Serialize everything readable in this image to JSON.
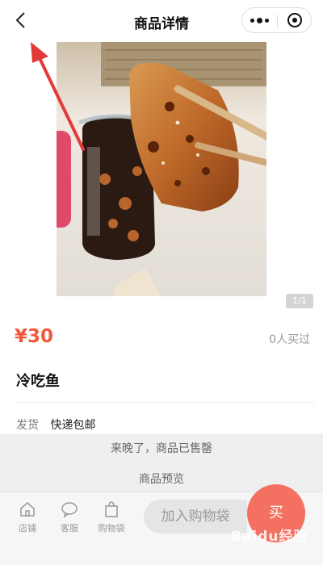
{
  "header": {
    "title": "商品详情",
    "back_icon": "chevron-left-icon",
    "menu_icon": "more-dots-icon",
    "close_icon": "target-circle-icon"
  },
  "gallery": {
    "pager": "1/1"
  },
  "product": {
    "price": "¥30",
    "sold_count": "0人买过",
    "name": "冷吃鱼",
    "shipping_label": "发货",
    "shipping_value": "快递包邮"
  },
  "notice": {
    "sold_out": "来晚了，商品已售罄",
    "preview": "商品预览"
  },
  "tabbar": {
    "store": "店铺",
    "service": "客服",
    "bag": "购物袋",
    "add_to_cart": "加入购物袋",
    "buy": "买"
  },
  "watermark": "Baidu经验",
  "colors": {
    "accent": "#f05a3c",
    "annotation_arrow": "#e23a3a",
    "buy_button": "#f47060"
  }
}
